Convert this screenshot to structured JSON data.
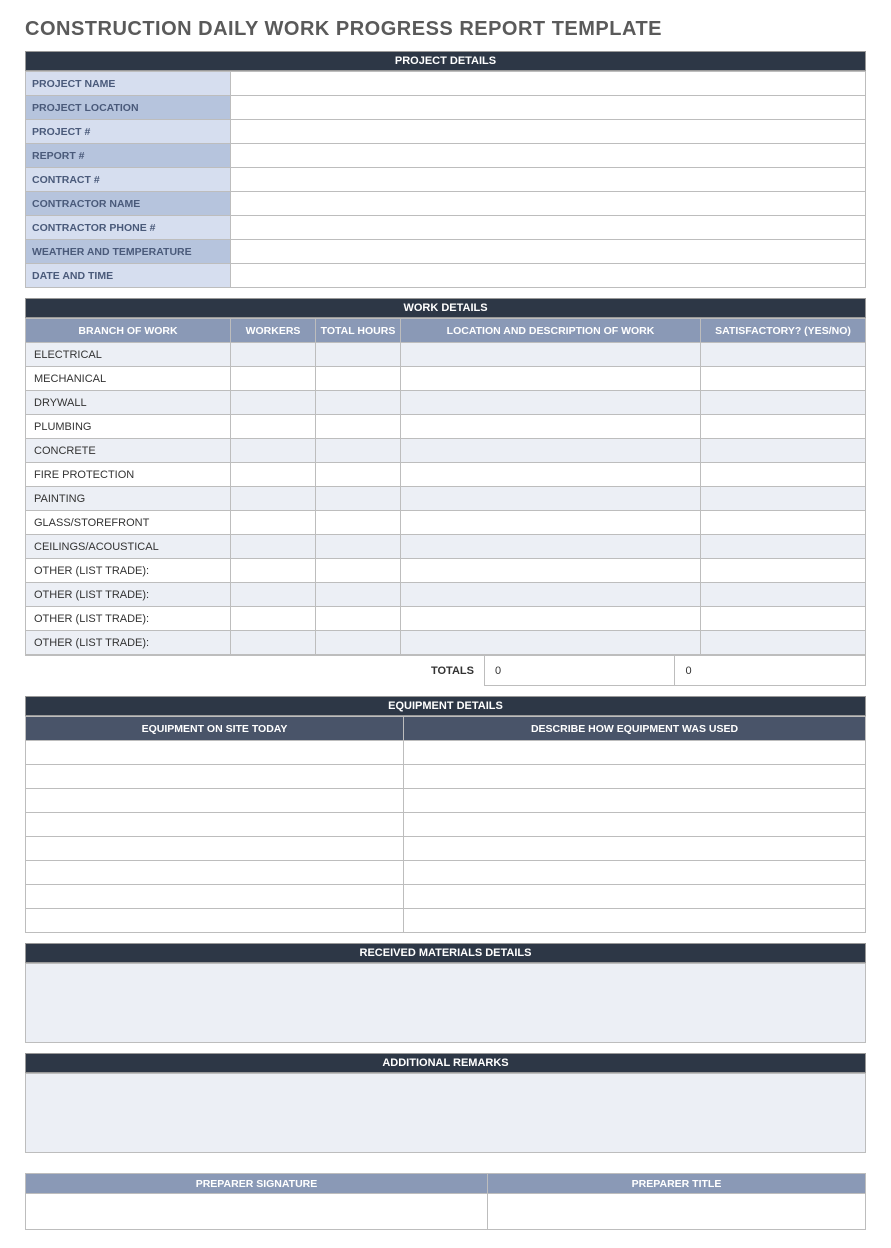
{
  "title": "CONSTRUCTION DAILY WORK PROGRESS REPORT TEMPLATE",
  "sections": {
    "project": "PROJECT DETAILS",
    "work": "WORK DETAILS",
    "equipment": "EQUIPMENT DETAILS",
    "materials": "RECEIVED MATERIALS DETAILS",
    "remarks": "ADDITIONAL REMARKS"
  },
  "project_fields": [
    "PROJECT NAME",
    "PROJECT LOCATION",
    "PROJECT #",
    "REPORT #",
    "CONTRACT #",
    "CONTRACTOR NAME",
    "CONTRACTOR PHONE #",
    "WEATHER AND TEMPERATURE",
    "DATE AND TIME"
  ],
  "work_headers": {
    "branch": "BRANCH OF WORK",
    "workers": "WORKERS",
    "hours": "TOTAL HOURS",
    "location": "LOCATION AND DESCRIPTION OF WORK",
    "satisfactory": "SATISFACTORY? (YES/NO)"
  },
  "work_rows": [
    "ELECTRICAL",
    "MECHANICAL",
    "DRYWALL",
    "PLUMBING",
    "CONCRETE",
    "FIRE PROTECTION",
    "PAINTING",
    "GLASS/STOREFRONT",
    "CEILINGS/ACOUSTICAL",
    "OTHER (LIST TRADE):",
    "OTHER (LIST TRADE):",
    "OTHER (LIST TRADE):",
    "OTHER (LIST TRADE):"
  ],
  "totals": {
    "label": "TOTALS",
    "workers": "0",
    "hours": "0"
  },
  "equipment_headers": {
    "onsite": "EQUIPMENT ON SITE TODAY",
    "usage": "DESCRIBE HOW EQUIPMENT WAS USED"
  },
  "equipment_row_count": 8,
  "signature_headers": {
    "signature": "PREPARER SIGNATURE",
    "title": "PREPARER TITLE"
  }
}
